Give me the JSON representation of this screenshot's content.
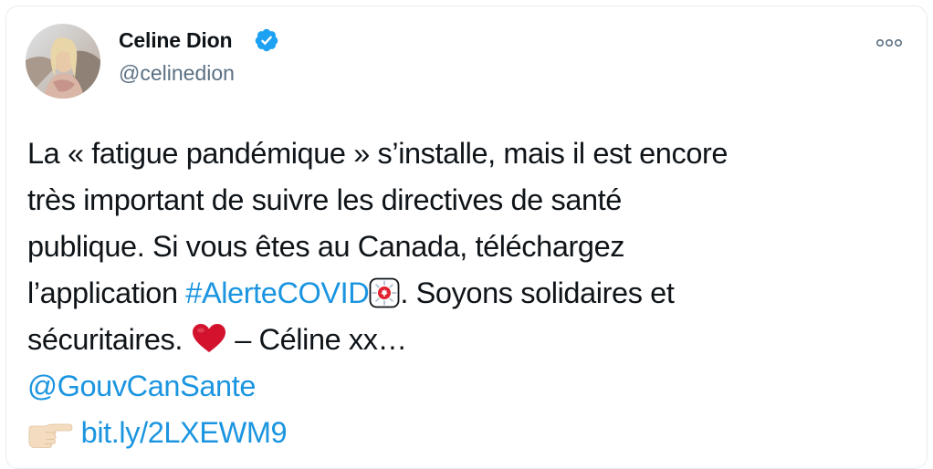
{
  "author": {
    "name": "Celine Dion",
    "handle": "@celinedion",
    "verified": true
  },
  "tweet": {
    "line1": "La « fatigue pandémique » s’installe, mais il est encore",
    "line2": "très important de suivre les directives de santé",
    "line3": "publique. Si vous êtes au Canada, téléchargez",
    "line4_pre": "l’application ",
    "hashtag": "#AlerteCOVID",
    "line4_post": ". Soyons solidaires et",
    "line5_pre": "sécuritaires. ",
    "line5_post": " – Céline xx…",
    "mention": "@GouvCanSante",
    "short_link": "bit.ly/2LXEWM9"
  },
  "icons": {
    "verified": "verified-badge-icon",
    "more": "more-options-icon",
    "app": "covid-alert-app-icon",
    "heart": "red-heart-emoji-icon",
    "pointing": "pointing-right-emoji-icon"
  },
  "colors": {
    "link": "#1b95e0",
    "text": "#0f1419",
    "secondary": "#5b7083",
    "verified": "#1da1f2",
    "heart": "#d3132e"
  }
}
